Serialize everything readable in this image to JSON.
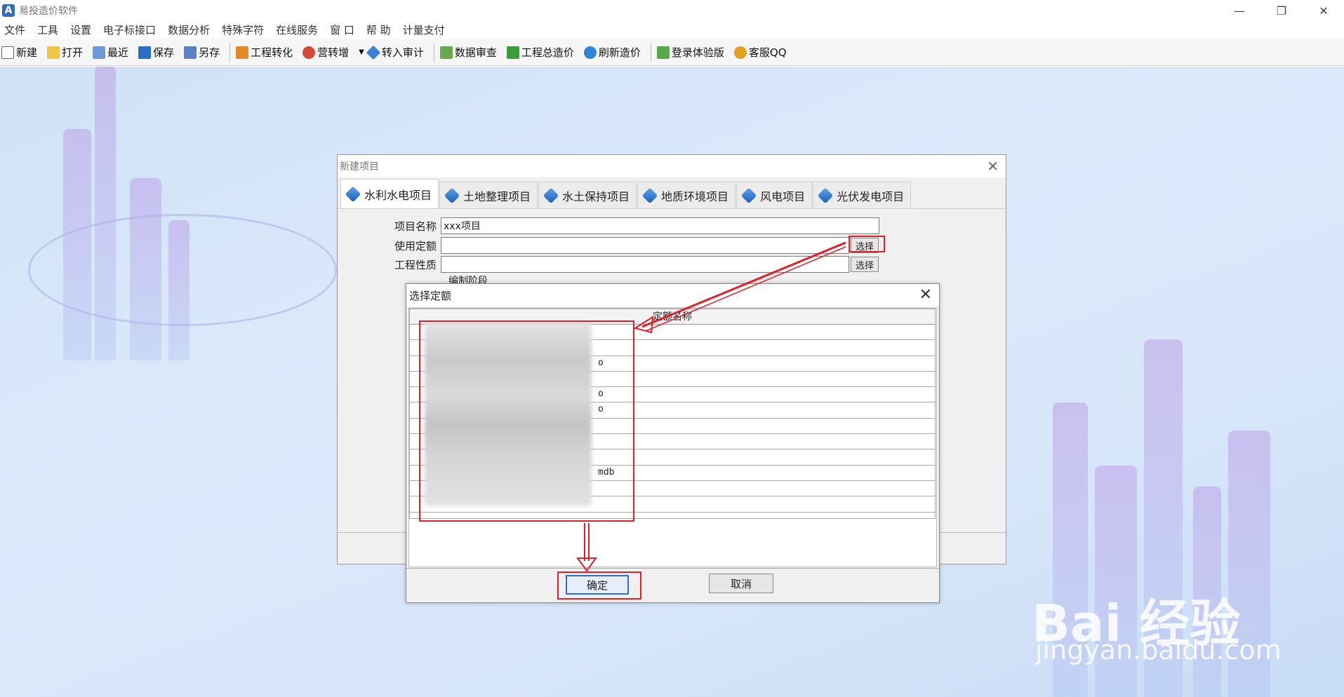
{
  "app": {
    "title": "易投造价软件"
  },
  "window_controls": {
    "minimize": "—",
    "maximize": "❐",
    "close": "✕"
  },
  "menu": [
    "文件",
    "工具",
    "设置",
    "电子标接口",
    "数据分析",
    "特殊字符",
    "在线服务",
    "窗 口",
    "帮 助",
    "计量支付"
  ],
  "toolbar": [
    {
      "label": "新建",
      "icon": "new-file-icon",
      "color": "#ffffff"
    },
    {
      "label": "打开",
      "icon": "open-folder-icon",
      "color": "#f3c44a"
    },
    {
      "label": "最近",
      "icon": "recent-icon",
      "color": "#6b9ad6"
    },
    {
      "label": "保存",
      "icon": "save-icon",
      "color": "#2a6fc6"
    },
    {
      "label": "另存",
      "icon": "save-as-icon",
      "color": "#5b84c4"
    },
    {
      "label": "工程转化",
      "icon": "convert-icon",
      "color": "#e08a2a"
    },
    {
      "label": "营转增",
      "icon": "tax-convert-icon",
      "color": "#d64a3a"
    },
    {
      "label": "转入审计",
      "icon": "audit-icon",
      "color": "#3b7fd9"
    },
    {
      "label": "数据审查",
      "icon": "data-review-icon",
      "color": "#6aa84f"
    },
    {
      "label": "工程总造价",
      "icon": "home-icon",
      "color": "#3c9c3c"
    },
    {
      "label": "刷新造价",
      "icon": "refresh-icon",
      "color": "#2f86d6"
    },
    {
      "label": "登录体验版",
      "icon": "login-icon",
      "color": "#59a84a"
    },
    {
      "label": "客服QQ",
      "icon": "qq-icon",
      "color": "#e0a020"
    }
  ],
  "dialog": {
    "title": "新建项目",
    "close": "✕",
    "tabs": [
      "水利水电项目",
      "土地整理项目",
      "水土保持项目",
      "地质环境项目",
      "风电项目",
      "光伏发电项目"
    ],
    "fields": {
      "project_name_label": "项目名称",
      "project_name_value": "xxx项目",
      "quota_label": "使用定额",
      "quota_value": "",
      "nature_label": "工程性质",
      "nature_value": "",
      "stage_label": "编制阶段"
    },
    "select_btn": "选择"
  },
  "inner_dialog": {
    "title": "选择定额",
    "close": "✕",
    "grid_header": "定额名称",
    "rows": [
      "",
      "",
      "o",
      "",
      "o",
      "o",
      "",
      "",
      "",
      "mdb",
      "",
      ""
    ],
    "ok": "确定",
    "cancel": "取消"
  },
  "watermark": {
    "brand": "Bai 经验",
    "url": "jingyan.baidu.com"
  }
}
